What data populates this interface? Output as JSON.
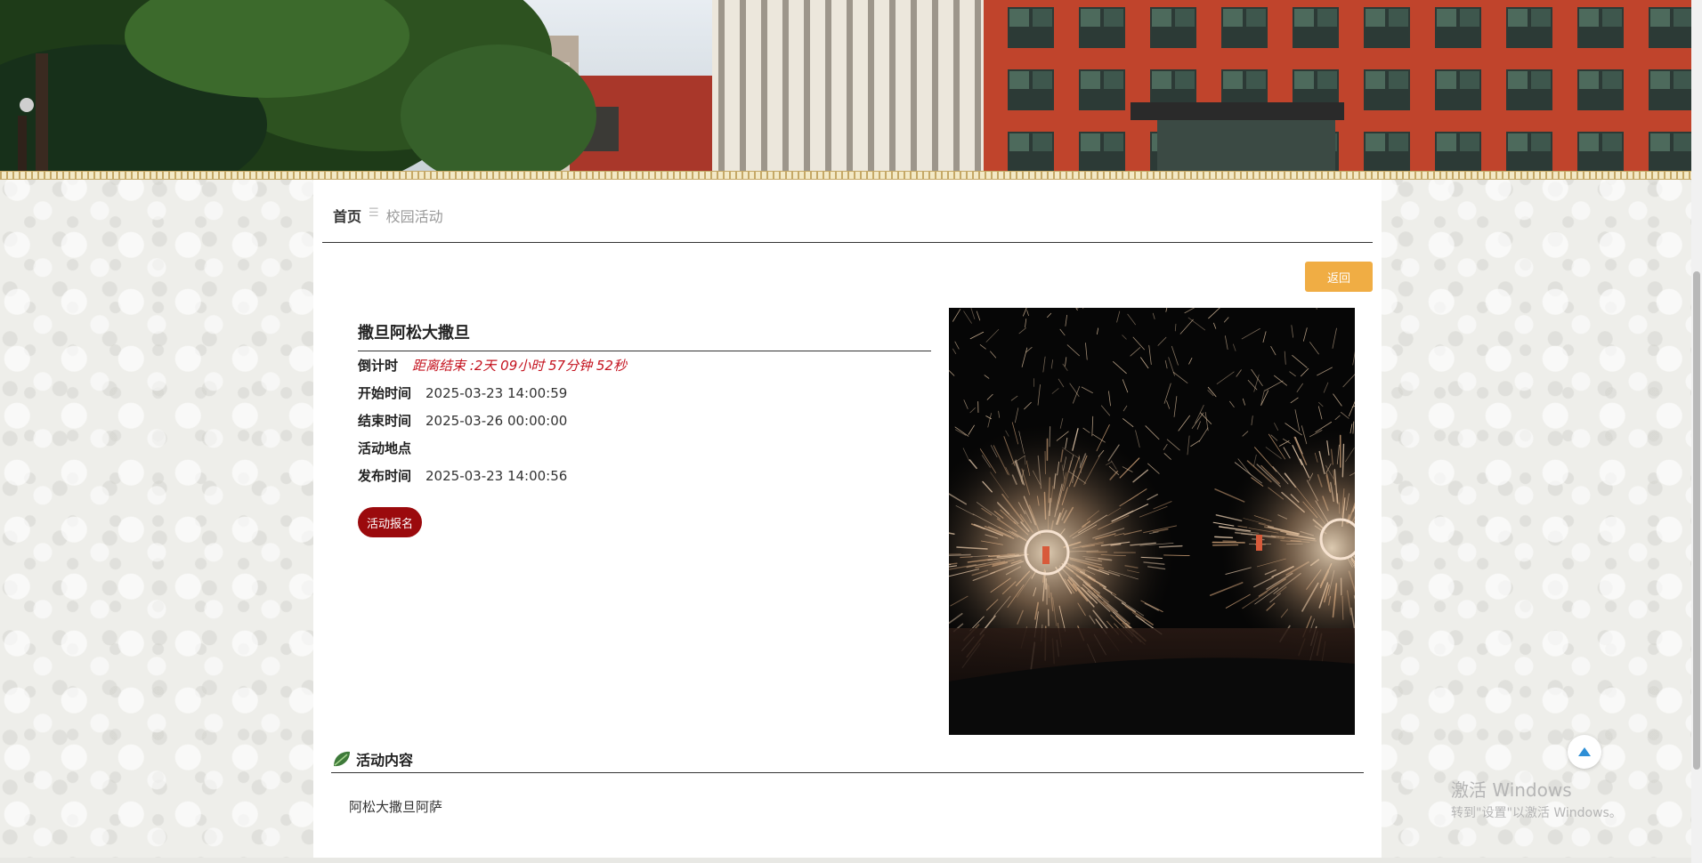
{
  "breadcrumb": {
    "home": "首页",
    "separator": "☰",
    "current": "校园活动"
  },
  "back_button": "返回",
  "activity": {
    "title": "撒旦阿松大撒旦",
    "countdown_label": "倒计时",
    "countdown_value": "距离结束 :2天 09小时 57分钟 52秒",
    "start_label": "开始时间",
    "start_value": "2025-03-23 14:00:59",
    "end_label": "结束时间",
    "end_value": "2025-03-26 00:00:00",
    "location_label": "活动地点",
    "location_value": "",
    "publish_label": "发布时间",
    "publish_value": "2025-03-23 14:00:56",
    "signup_button": "活动报名"
  },
  "content_section": {
    "heading": "活动内容",
    "body": "阿松大撒旦阿萨"
  },
  "watermark": {
    "line1": "激活 Windows",
    "line2": "转到\"设置\"以激活 Windows。"
  },
  "colors": {
    "accent_orange": "#f0ad44",
    "signup_red": "#9b0a0d",
    "countdown_red": "#c4121e"
  }
}
